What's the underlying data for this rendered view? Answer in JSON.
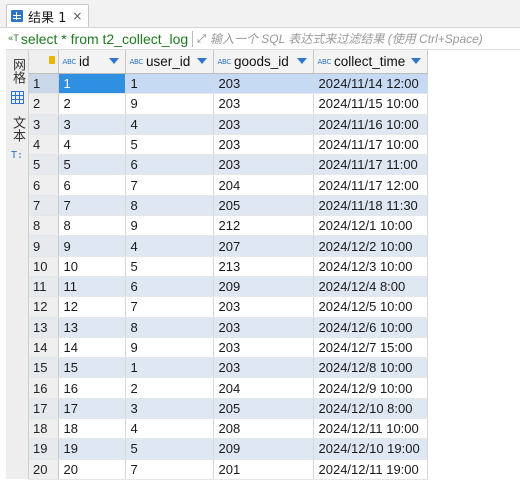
{
  "tab": {
    "title": "结果 1",
    "close": "×"
  },
  "filter": {
    "sql": "select * from t2_collect_log",
    "placeholder": "输入一个 SQL 表达式来过滤结果 (使用 Ctrl+Space)",
    "expand_icon": "expand-icon"
  },
  "side_panel": {
    "grid_label": "网格",
    "text_label": "文本"
  },
  "columns": [
    {
      "name": "id",
      "type_badge": "ABC"
    },
    {
      "name": "user_id",
      "type_badge": "ABC"
    },
    {
      "name": "goods_id",
      "type_badge": "ABC"
    },
    {
      "name": "collect_time",
      "type_badge": "ABC"
    }
  ],
  "rows": [
    {
      "n": "1",
      "cells": [
        "1",
        "1",
        "203",
        "2024/11/14 12:00"
      ]
    },
    {
      "n": "2",
      "cells": [
        "2",
        "9",
        "203",
        "2024/11/15 10:00"
      ]
    },
    {
      "n": "3",
      "cells": [
        "3",
        "4",
        "203",
        "2024/11/16 10:00"
      ]
    },
    {
      "n": "4",
      "cells": [
        "4",
        "5",
        "203",
        "2024/11/17 10:00"
      ]
    },
    {
      "n": "5",
      "cells": [
        "5",
        "6",
        "203",
        "2024/11/17 11:00"
      ]
    },
    {
      "n": "6",
      "cells": [
        "6",
        "7",
        "204",
        "2024/11/17 12:00"
      ]
    },
    {
      "n": "7",
      "cells": [
        "7",
        "8",
        "205",
        "2024/11/18 11:30"
      ]
    },
    {
      "n": "8",
      "cells": [
        "8",
        "9",
        "212",
        "2024/12/1 10:00"
      ]
    },
    {
      "n": "9",
      "cells": [
        "9",
        "4",
        "207",
        "2024/12/2 10:00"
      ]
    },
    {
      "n": "10",
      "cells": [
        "10",
        "5",
        "213",
        "2024/12/3 10:00"
      ]
    },
    {
      "n": "11",
      "cells": [
        "11",
        "6",
        "209",
        "2024/12/4 8:00"
      ]
    },
    {
      "n": "12",
      "cells": [
        "12",
        "7",
        "203",
        "2024/12/5 10:00"
      ]
    },
    {
      "n": "13",
      "cells": [
        "13",
        "8",
        "203",
        "2024/12/6 10:00"
      ]
    },
    {
      "n": "14",
      "cells": [
        "14",
        "9",
        "203",
        "2024/12/7 15:00"
      ]
    },
    {
      "n": "15",
      "cells": [
        "15",
        "1",
        "203",
        "2024/12/8 10:00"
      ]
    },
    {
      "n": "16",
      "cells": [
        "16",
        "2",
        "204",
        "2024/12/9 10:00"
      ]
    },
    {
      "n": "17",
      "cells": [
        "17",
        "3",
        "205",
        "2024/12/10 8:00"
      ]
    },
    {
      "n": "18",
      "cells": [
        "18",
        "4",
        "208",
        "2024/12/11 10:00"
      ]
    },
    {
      "n": "19",
      "cells": [
        "19",
        "5",
        "209",
        "2024/12/10 19:00"
      ]
    },
    {
      "n": "20",
      "cells": [
        "20",
        "7",
        "201",
        "2024/12/11 19:00"
      ]
    }
  ],
  "colors": {
    "selected_cell": "#2f8fe0",
    "selected_row": "#c6daf3",
    "alt_row": "#dfe7f3",
    "sql_text": "#1f7a1f"
  }
}
